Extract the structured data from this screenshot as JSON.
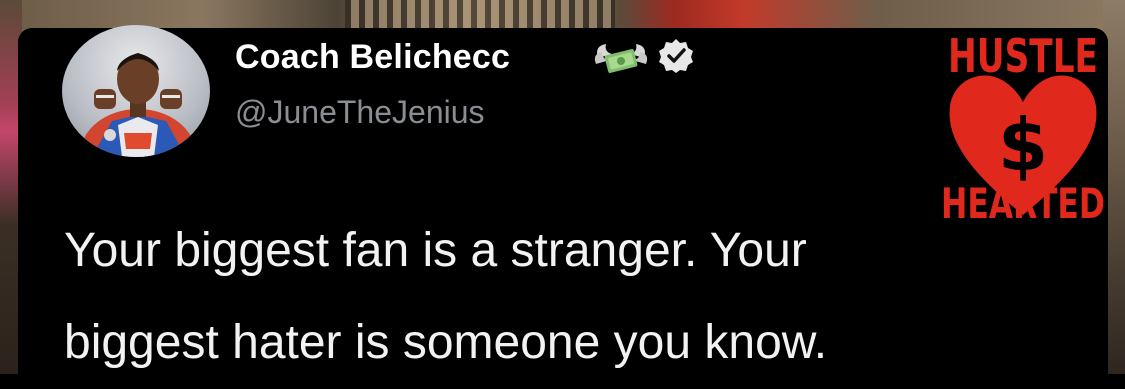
{
  "tweet": {
    "display_name": "Coach Belichecc",
    "handle": "@JuneTheJenius",
    "text_lines": [
      "Your biggest fan is a stranger. Your",
      "biggest hater is someone you know."
    ],
    "badges": [
      "money-with-wings-icon",
      "verified-check-icon"
    ]
  },
  "logo": {
    "line1": "HUSTLE",
    "symbol": "$",
    "line2": "HEARTED",
    "color": "#e0281c"
  },
  "colors": {
    "background": "#000000",
    "name": "#ffffff",
    "handle": "#8a8d91",
    "text": "#f2f2f2"
  }
}
